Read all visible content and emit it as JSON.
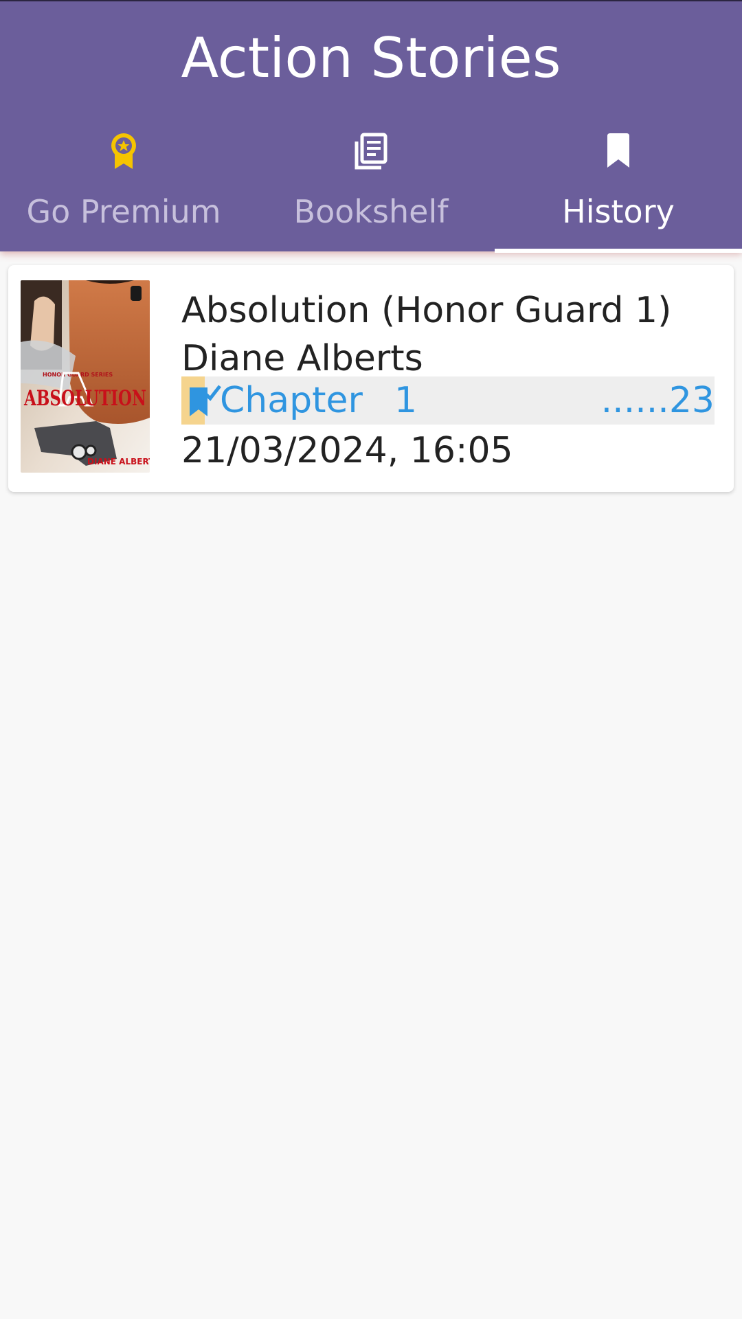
{
  "app": {
    "title": "Action Stories"
  },
  "tabs": [
    {
      "label": "Go Premium",
      "icon": "premium-badge-icon",
      "icon_color": "#f5c400",
      "active": false
    },
    {
      "label": "Bookshelf",
      "icon": "library-books-icon",
      "active": false
    },
    {
      "label": "History",
      "icon": "bookmark-icon",
      "active": true
    }
  ],
  "history": {
    "items": [
      {
        "cover": {
          "series_text": "HONOR GUARD SERIES",
          "title_text": "ABSOLUTION",
          "author_text": "DIANE ALBERTS"
        },
        "title": "Absolution (Honor Guard 1)",
        "author": "Diane Alberts",
        "chapter_label": "Chapter",
        "chapter_number": "1",
        "chapter_total": "......23",
        "read_at": "21/03/2024, 16:05"
      }
    ]
  },
  "colors": {
    "header": "#6b5e9b",
    "accent_blue": "#2f95e0",
    "premium_yellow": "#f5c400",
    "marker_yellow": "#f5d48e"
  }
}
